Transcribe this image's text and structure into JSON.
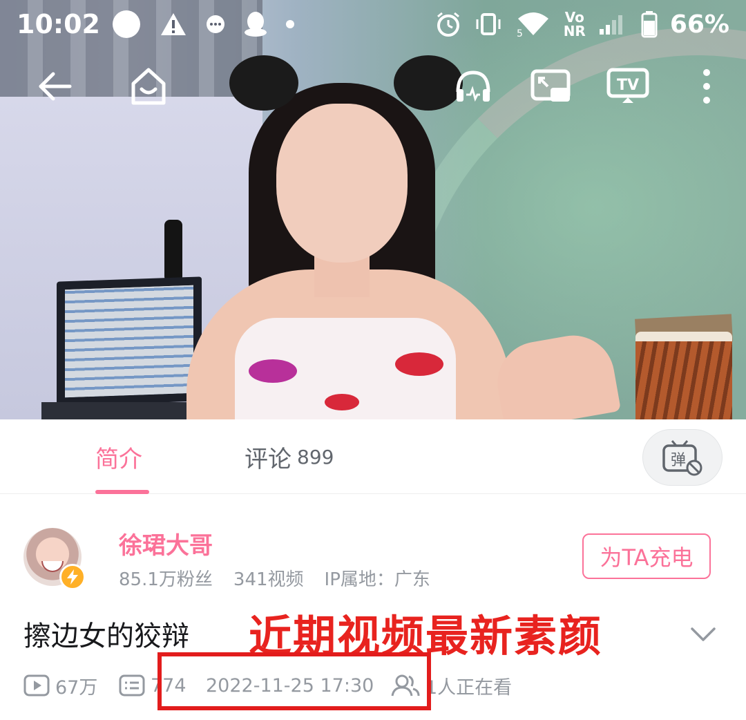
{
  "status_bar": {
    "time": "10:02",
    "battery_percent": "66%",
    "network_label": "5",
    "volte_label": "Vo",
    "nr_label": "NR"
  },
  "player": {
    "controls": [
      "back-icon",
      "home-icon",
      "audio-mode-icon",
      "small-window-icon",
      "tv-cast-icon",
      "more-icon"
    ],
    "tv_label": "TV"
  },
  "tabs": {
    "intro_label": "简介",
    "comments_label": "评论",
    "comments_count": "899",
    "danmaku_label": "弹"
  },
  "uploader": {
    "name": "徐珺大哥",
    "followers": "85.1万粉丝",
    "videos": "341视频",
    "ip_location": "IP属地：广东",
    "charge_button": "为TA充电"
  },
  "video": {
    "title": "擦边女的狡辩",
    "overlay_caption": "近期视频最新素颜",
    "plays": "67万",
    "danmaku_count": "774",
    "publish_time": "2022-11-25 17:30",
    "watching_now": "1人正在看"
  },
  "colors": {
    "accent_pink": "#fb7299",
    "annotation_red": "#e21c1c",
    "text_gray": "#9499a0"
  }
}
